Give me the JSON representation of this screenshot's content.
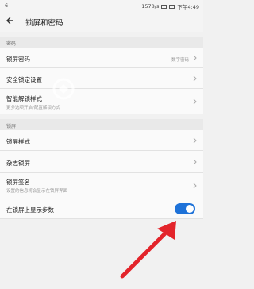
{
  "status": {
    "left": "6",
    "speed": "1578/s",
    "time": "下午4:49"
  },
  "header": {
    "title": "锁屏和密码"
  },
  "sections": {
    "password": "密码",
    "lockscreen": "锁屏"
  },
  "items": {
    "lock_password": {
      "label": "锁屏密码",
      "value": "数字密码"
    },
    "secure_lock": {
      "label": "安全锁定设置"
    },
    "smart_unlock": {
      "label": "智能解锁样式",
      "sub": "更多选项开启/配置解锁方式"
    },
    "lock_style": {
      "label": "锁屏样式"
    },
    "magazine": {
      "label": "杂志锁屏"
    },
    "signature": {
      "label": "锁屏签名",
      "sub": "设置的信息将会显示在锁屏界面"
    },
    "steps": {
      "label": "在锁屏上显示步数",
      "toggle": true
    }
  },
  "colors": {
    "accent": "#1e72d8",
    "arrow": "#e3242b"
  },
  "icons": {
    "back": "back-arrow-icon",
    "chevron": "chevron-right-icon"
  }
}
